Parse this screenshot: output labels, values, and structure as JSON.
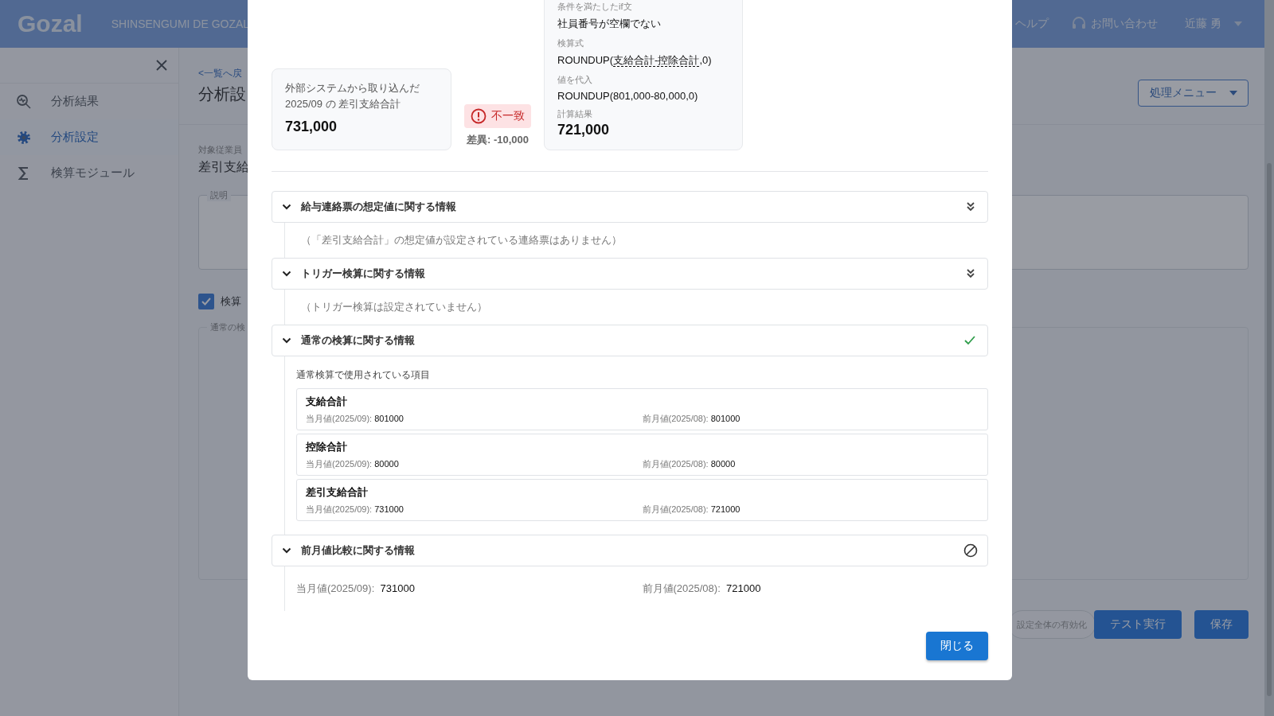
{
  "header": {
    "logo": "Gozal",
    "org": "SHINSENGUMI DE GOZAL",
    "help": "ヘルプ",
    "contact": "お問い合わせ",
    "user": "近藤 勇"
  },
  "sidebar": {
    "items": [
      {
        "label": "分析結果",
        "selected": false
      },
      {
        "label": "分析設定",
        "selected": true
      },
      {
        "label": "検算モジュール",
        "selected": false
      }
    ]
  },
  "page": {
    "back_link": "<一覧へ戻",
    "title": "分析設",
    "field_label": "対象従業員",
    "field_value": "差引支給",
    "description_label": "説明",
    "checkbox": {
      "label": "検算",
      "checked": true
    },
    "section_label": "通常の検",
    "menu_button": "処理メニュー",
    "toggle_button": "設定全体の有効化",
    "test_button": "テスト実行",
    "save_button": "保存"
  },
  "dialog": {
    "imported": {
      "caption_lines": [
        "外部システムから取り込んだ",
        "2025/09 の 差引支給合計"
      ],
      "value": "731,000"
    },
    "result": {
      "matched": false,
      "label": "不一致",
      "difference": "差異: -10,000"
    },
    "calculation": [
      {
        "label": "条件を満たしたif文",
        "kind": "text",
        "parts": [
          {
            "text": "社員番号が空欄でない",
            "kind": "plain"
          }
        ]
      },
      {
        "label": "検算式",
        "kind": "text",
        "parts": [
          {
            "text": "ROUNDUP(",
            "kind": "plain"
          },
          {
            "text": "支給合計-控除合計",
            "kind": "reference"
          },
          {
            "text": ",0)",
            "kind": "plain"
          }
        ]
      },
      {
        "label": "値を代入",
        "kind": "text",
        "parts": [
          {
            "text": "ROUNDUP(801,000-80,000,0)",
            "kind": "plain"
          }
        ]
      },
      {
        "label": "計算結果",
        "kind": "result",
        "parts": [
          {
            "text": "721,000",
            "kind": "plain"
          }
        ]
      }
    ],
    "sections": [
      {
        "title": "給与連絡票の想定値に関する情報",
        "expanded": true,
        "checked": false,
        "disabled": false,
        "kind": "note",
        "note": "（「差引支給合計」の想定値が設定されている連絡票はありません）"
      },
      {
        "title": "トリガー検算に関する情報",
        "expanded": true,
        "checked": false,
        "disabled": false,
        "kind": "note",
        "note": "（トリガー検算は設定されていません）"
      },
      {
        "title": "通常の検算に関する情報",
        "expanded": true,
        "checked": true,
        "disabled": false,
        "kind": "items",
        "subtitle": "通常検算で使用されている項目",
        "items": [
          {
            "name": "支給合計",
            "current_label": "当月値(2025/09):",
            "current": "801000",
            "previous_label": "前月値(2025/08):",
            "previous": "801000"
          },
          {
            "name": "控除合計",
            "current_label": "当月値(2025/09):",
            "current": "80000",
            "previous_label": "前月値(2025/08):",
            "previous": "80000"
          },
          {
            "name": "差引支給合計",
            "current_label": "当月値(2025/09):",
            "current": "731000",
            "previous_label": "前月値(2025/08):",
            "previous": "721000"
          }
        ]
      },
      {
        "title": "前月値比較に関する情報",
        "expanded": true,
        "checked": false,
        "disabled": true,
        "kind": "compare",
        "current_label": "当月値(2025/09):",
        "current": "731000",
        "previous_label": "前月値(2025/08):",
        "previous": "721000"
      }
    ],
    "close_button": "閉じる"
  }
}
